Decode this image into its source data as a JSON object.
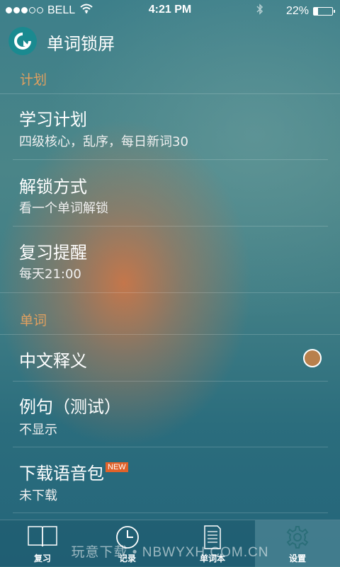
{
  "status_bar": {
    "carrier": "BELL",
    "time": "4:21 PM",
    "battery_percent": "22%",
    "battery_level": 0.22,
    "signal_dots": 5,
    "signal_filled": 3
  },
  "header": {
    "title": "单词锁屏",
    "logo_icon": "q-logo-icon"
  },
  "sections": [
    {
      "label": "计划",
      "items": [
        {
          "title": "学习计划",
          "subtitle": "四级核心，乱序，每日新词30"
        },
        {
          "title": "解锁方式",
          "subtitle": "看一个单词解锁"
        },
        {
          "title": "复习提醒",
          "subtitle": "每天21:00"
        }
      ]
    },
    {
      "label": "单词",
      "items": [
        {
          "title": "中文释义",
          "toggle": true
        },
        {
          "title": "例句（测试）",
          "subtitle": "不显示"
        },
        {
          "title": "下载语音包",
          "badge": "NEW",
          "subtitle": "未下载"
        }
      ]
    }
  ],
  "tabs": [
    {
      "label": "复习",
      "icon": "book-icon",
      "active": false
    },
    {
      "label": "记录",
      "icon": "clock-icon",
      "active": false
    },
    {
      "label": "单词本",
      "icon": "notebook-icon",
      "active": false
    },
    {
      "label": "设置",
      "icon": "gear-icon",
      "active": true
    }
  ],
  "watermark": "玩意下载 • NBWYXH.COM.CN",
  "colors": {
    "section_header": "#e0a060",
    "toggle_fill": "#b8804c",
    "badge": "#e0622a",
    "logo": "#1a8a90"
  }
}
